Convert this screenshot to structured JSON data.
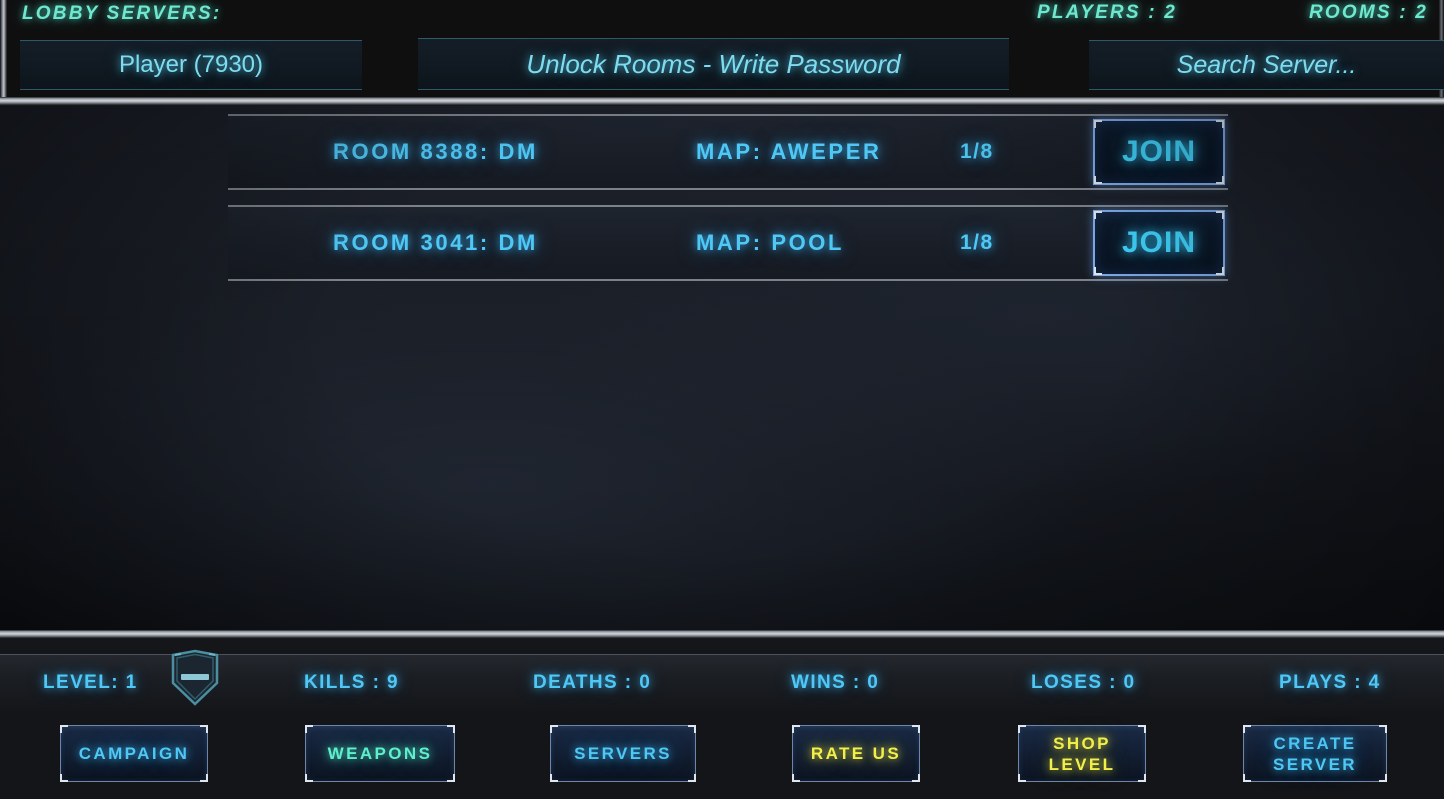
{
  "header": {
    "lobby_title": "LOBBY SERVERS:",
    "players_label": "PLAYERS : 2",
    "rooms_label": "ROOMS : 2",
    "player_field_value": "Player (7930)",
    "password_field_placeholder": "Unlock Rooms - Write Password",
    "search_field_placeholder": "Search  Server..."
  },
  "servers": {
    "rows": [
      {
        "room": "ROOM 8388: DM",
        "map": "MAP: AWEPER",
        "slots": "1/8",
        "join_label": "JOIN"
      },
      {
        "room": "ROOM 3041: DM",
        "map": "MAP: POOL",
        "slots": "1/8",
        "join_label": "JOIN"
      }
    ]
  },
  "stats": {
    "level": "LEVEL: 1",
    "kills": "KILLS : 9",
    "deaths": "DEATHS : 0",
    "wins": "WINS : 0",
    "loses": "LOSES : 0",
    "plays": "PLAYS : 4",
    "badge_icon": "shield-rank-icon"
  },
  "nav": {
    "buttons": [
      {
        "label": "CAMPAIGN",
        "color": "#4fc8f5"
      },
      {
        "label": "WEAPONS",
        "color": "#5ef0cd"
      },
      {
        "label": "SERVERS",
        "color": "#4fc8f5"
      },
      {
        "label": "RATE US",
        "color": "#f3f04a"
      },
      {
        "label": "SHOP\nLEVEL",
        "color": "#f3f04a"
      },
      {
        "label": "CREATE\nSERVER",
        "color": "#4fc8f5"
      }
    ]
  },
  "colors": {
    "accent_cyan": "#4fc8f5",
    "accent_teal": "#6fe8cf",
    "accent_yellow": "#f3f04a",
    "panel_bg": "#1a1e26",
    "header_bg": "#100f10"
  }
}
